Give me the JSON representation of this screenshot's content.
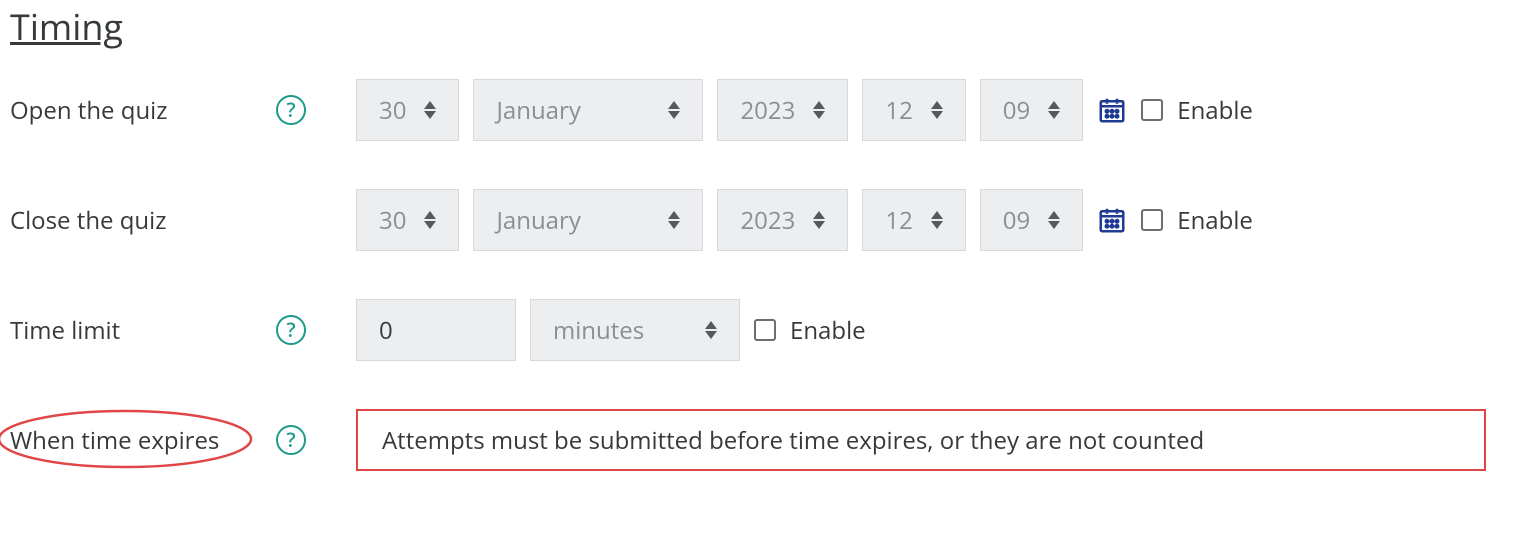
{
  "section": {
    "title": "Timing"
  },
  "rows": {
    "open": {
      "label": "Open the quiz",
      "day": "30",
      "month": "January",
      "year": "2023",
      "hour": "12",
      "minute": "09",
      "enable": "Enable"
    },
    "close": {
      "label": "Close the quiz",
      "day": "30",
      "month": "January",
      "year": "2023",
      "hour": "12",
      "minute": "09",
      "enable": "Enable"
    },
    "limit": {
      "label": "Time limit",
      "value": "0",
      "unit": "minutes",
      "enable": "Enable"
    },
    "expires": {
      "label": "When time expires",
      "value": "Attempts must be submitted before time expires, or they are not counted"
    }
  }
}
